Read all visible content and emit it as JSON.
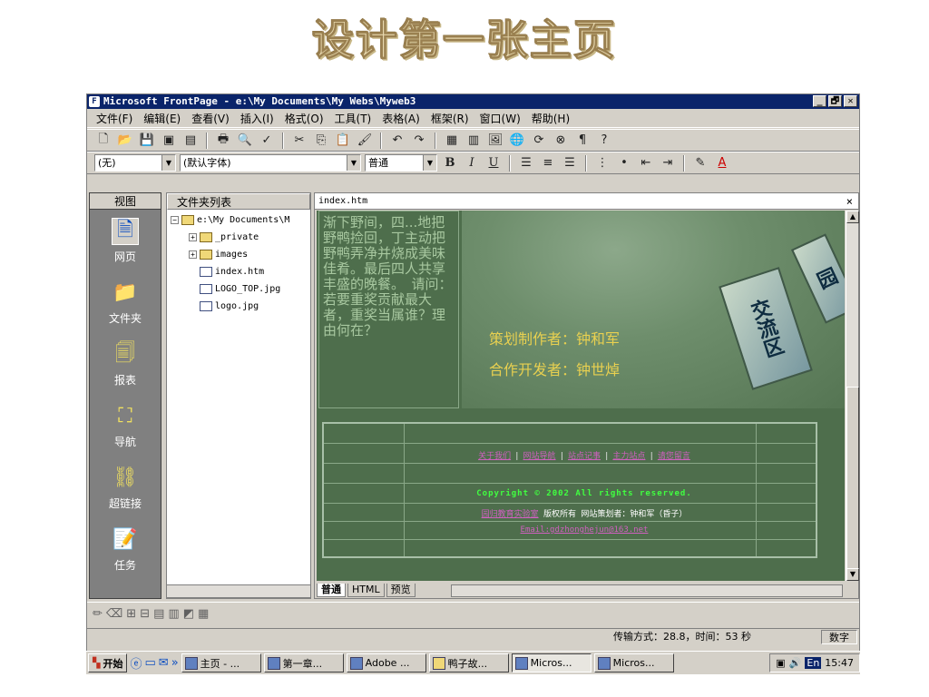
{
  "slide": {
    "title": "设计第一张主页"
  },
  "window": {
    "title": "Microsoft FrontPage - e:\\My Documents\\My Webs\\Myweb3",
    "buttons": {
      "minimize": "_",
      "maximize": "🗗",
      "close": "✕"
    }
  },
  "menu": [
    "文件(F)",
    "编辑(E)",
    "查看(V)",
    "插入(I)",
    "格式(O)",
    "工具(T)",
    "表格(A)",
    "框架(R)",
    "窗口(W)",
    "帮助(H)"
  ],
  "formatting": {
    "style": "(无)",
    "font": "(默认字体)",
    "size": "普通",
    "bold": "B",
    "italic": "I",
    "underline": "U"
  },
  "views": {
    "header": "视图",
    "items": [
      {
        "label": "网页",
        "icon": "page-icon"
      },
      {
        "label": "文件夹",
        "icon": "folder-icon"
      },
      {
        "label": "报表",
        "icon": "reports-icon"
      },
      {
        "label": "导航",
        "icon": "navigation-icon"
      },
      {
        "label": "超链接",
        "icon": "hyperlinks-icon"
      },
      {
        "label": "任务",
        "icon": "tasks-icon"
      }
    ]
  },
  "folders": {
    "header": "文件夹列表",
    "root": "e:\\My Documents\\M",
    "items": [
      "_private",
      "images",
      "index.htm",
      "LOGO_TOP.jpg",
      "logo.jpg"
    ]
  },
  "editor": {
    "filename": "index.htm",
    "close": "×",
    "story_text": "渐下野间，四...地把野鸭捡回，丁主动把野鸭弄净并烧成美味佳肴。最后四人共享丰盛的晚餐。　请问：若要重奖贡献最大者，重奖当属谁？理由何在？",
    "credits": [
      "策划制作者：钟和军",
      "合作开发者：钟世焯"
    ],
    "hero_tags": [
      "交流区",
      "园"
    ],
    "footer": {
      "links": [
        "关于我们",
        "网站导航",
        "站点记事",
        "主力站点",
        "请您留言"
      ],
      "copyright": "Copyright © 2002  All rights reserved.",
      "owner_link": "园归教育实验室",
      "owner_text": "版权所有 网站策划者：钟和军（昏子）",
      "email": "Email:gdzhonghejun@163.net"
    },
    "tabs": [
      "普通",
      "HTML",
      "预览"
    ]
  },
  "status": {
    "transfer": "传输方式：28.8，时间：53 秒",
    "mode": "数字"
  },
  "taskbar": {
    "start": "开始",
    "quick_more": "»",
    "tasks": [
      "主页 - ...",
      "第一章...",
      "Adobe ...",
      "鸭子故...",
      "Micros...",
      "Micros..."
    ],
    "lang": "En",
    "time": "15:47"
  }
}
